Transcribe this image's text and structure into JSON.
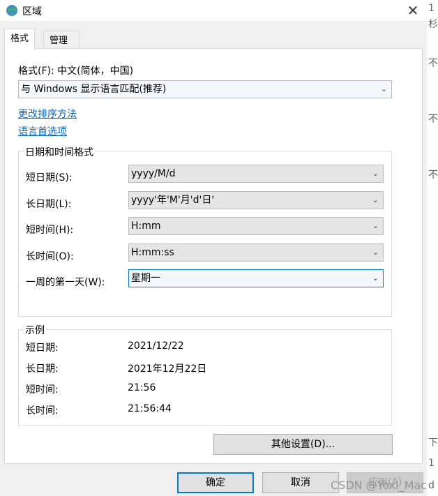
{
  "window": {
    "title": "区域",
    "close_glyph": "✕"
  },
  "tabs": [
    {
      "label": "格式",
      "active": true
    },
    {
      "label": "管理",
      "active": false
    }
  ],
  "format": {
    "label": "格式(F): 中文(简体，中国)",
    "value": "与 Windows 显示语言匹配(推荐)"
  },
  "links": {
    "sort": "更改排序方法",
    "language": "语言首选项"
  },
  "datetime_group": {
    "title": "日期和时间格式",
    "rows": [
      {
        "label": "短日期(S):",
        "value": "yyyy/M/d"
      },
      {
        "label": "长日期(L):",
        "value": "yyyy'年'M'月'd'日'"
      },
      {
        "label": "短时间(H):",
        "value": "H:mm"
      },
      {
        "label": "长时间(O):",
        "value": "H:mm:ss"
      },
      {
        "label": "一周的第一天(W):",
        "value": "星期一"
      }
    ]
  },
  "example_group": {
    "title": "示例",
    "rows": [
      {
        "label": "短日期:",
        "value": "2021/12/22"
      },
      {
        "label": "长日期:",
        "value": "2021年12月22日"
      },
      {
        "label": "短时间:",
        "value": "21:56"
      },
      {
        "label": "长时间:",
        "value": "21:56:44"
      }
    ]
  },
  "buttons": {
    "other_settings": "其他设置(D)...",
    "ok": "确定",
    "cancel": "取消",
    "apply": "应用(A)"
  },
  "watermark": "CSDN @Yoxi_Mac",
  "background_chars": [
    "1",
    "杉",
    "不",
    "不",
    "不",
    "下",
    "1",
    "d"
  ],
  "colors": {
    "link": "#0066cc",
    "focus_border": "#0078d7"
  }
}
